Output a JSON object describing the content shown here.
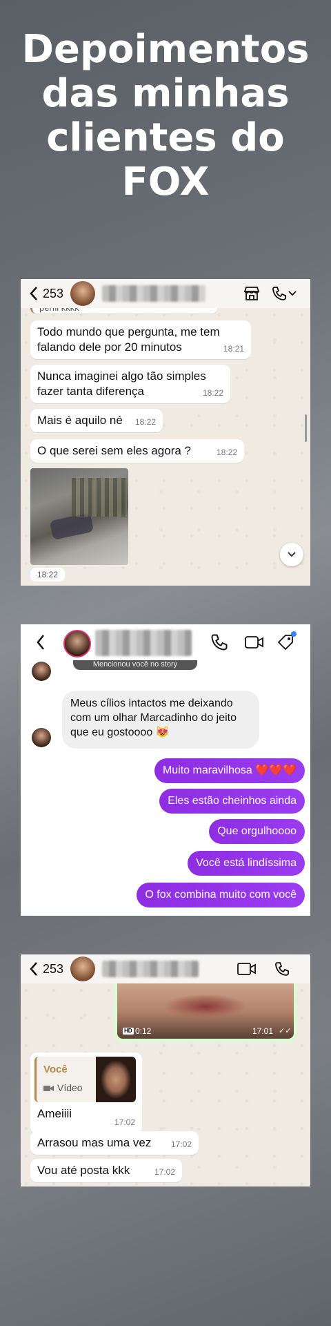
{
  "title": "Depoimentos das minhas clientes do FOX",
  "shot1": {
    "count": "253",
    "top_cut": "perfil kkkk",
    "messages": [
      {
        "text": "Todo mundo que pergunta, me tem falando dele por 20 minutos",
        "time": "18:21"
      },
      {
        "text": "Nunca imaginei algo tão simples fazer tanta diferença",
        "time": "18:22"
      },
      {
        "text": "Mais é aquilo né",
        "time": "18:22"
      },
      {
        "text": "O que serei sem eles agora ?",
        "time": "18:22"
      }
    ],
    "photo_time": "18:22"
  },
  "shot2": {
    "story_cut": "Mencionou você no story",
    "incoming": "Meus cílios intactos me deixando com um olhar Marcadinho do jeito que eu gostoooo 😻",
    "outgoing": [
      "Muito maravilhosa ❤️❤️❤️",
      "Eles estão cheinhos ainda",
      "Que orgulhoooo",
      "Você está lindíssima",
      "O fox combina muito com você"
    ]
  },
  "shot3": {
    "count": "253",
    "video_duration": "0:12",
    "video_time": "17:01",
    "reply_author": "Você",
    "reply_kind": "Vídeo",
    "messages": [
      {
        "text": "Ameiiii",
        "time": "17:02"
      },
      {
        "text": "Arrasou mas uma vez",
        "time": "17:02"
      },
      {
        "text": "Vou até posta kkk",
        "time": "17:02"
      }
    ]
  }
}
